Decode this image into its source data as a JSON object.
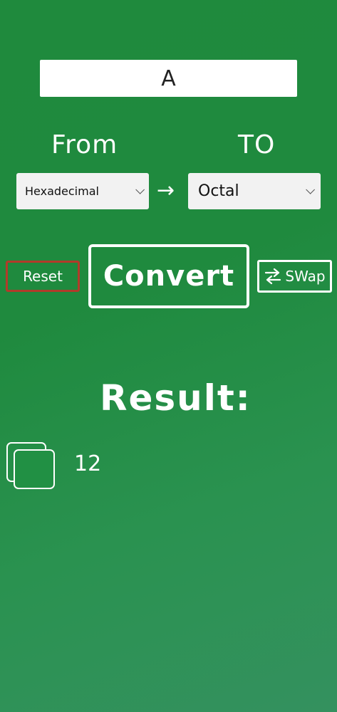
{
  "input": {
    "value": "A"
  },
  "labels": {
    "from": "From",
    "to": "TO"
  },
  "from_select": {
    "selected": "Hexadecimal"
  },
  "to_select": {
    "selected": "Octal"
  },
  "buttons": {
    "reset": "Reset",
    "convert": "Convert",
    "swap": "SWap"
  },
  "result": {
    "heading": "Result:",
    "value": "12"
  },
  "icons": {
    "arrow": "right-arrow-icon",
    "swap": "swap-arrows-icon",
    "copy": "copy-icon"
  },
  "colors": {
    "background": "#1f8a3d",
    "reset_border": "#b23b2a",
    "text": "#ffffff"
  }
}
